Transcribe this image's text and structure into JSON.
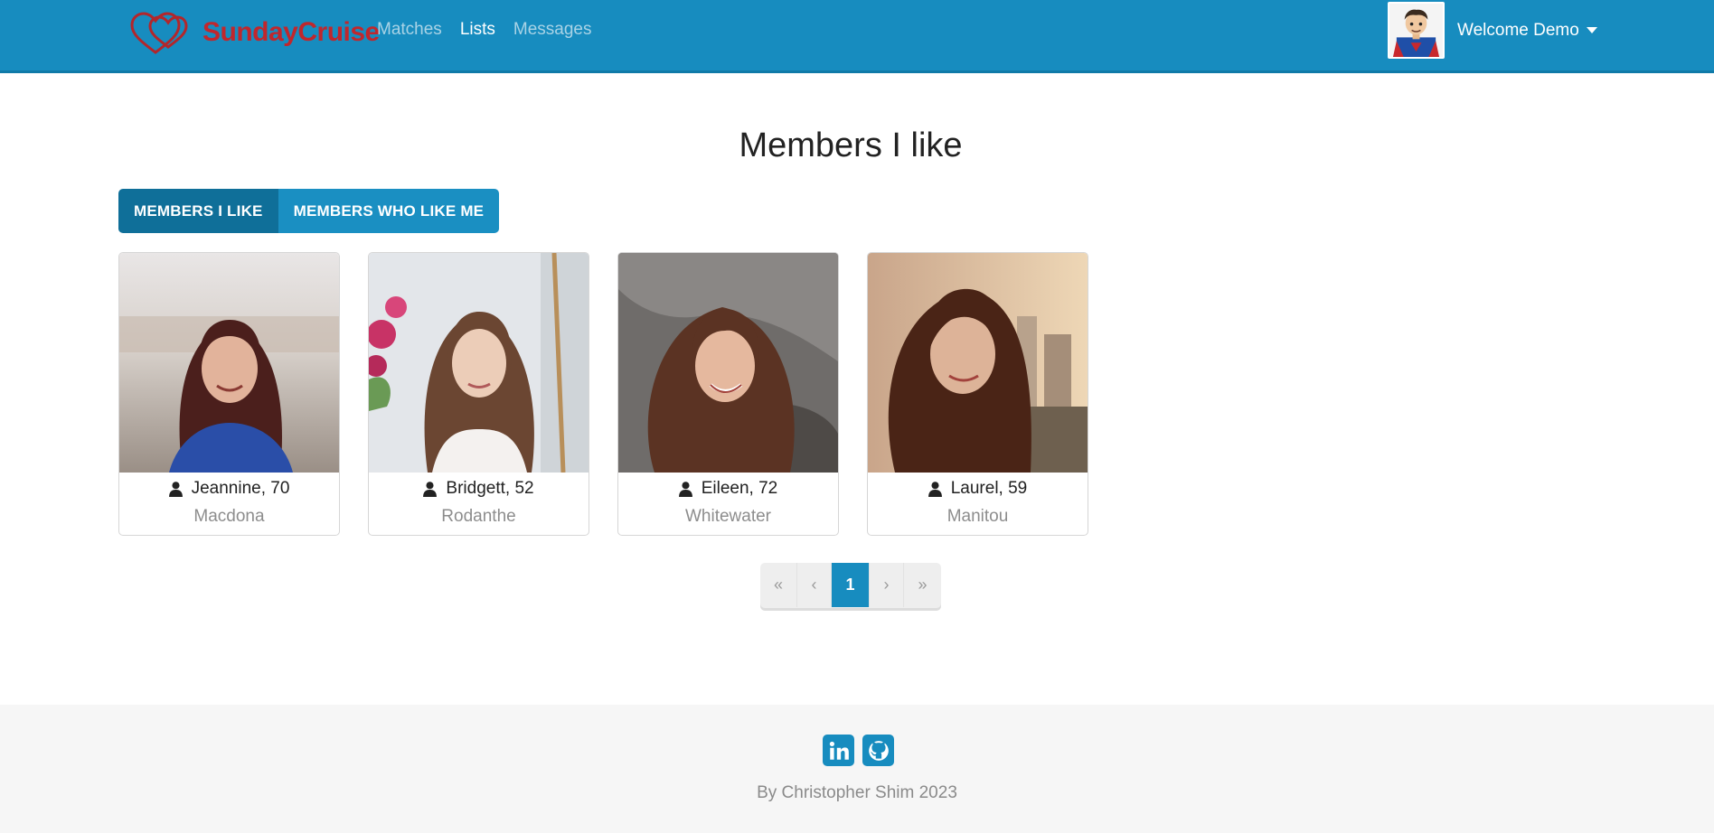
{
  "brand": {
    "name": "SundayCruise",
    "color": "#c0272d",
    "icon": "hearts-logo"
  },
  "nav": {
    "links": [
      {
        "label": "Matches",
        "active": false
      },
      {
        "label": "Lists",
        "active": true
      },
      {
        "label": "Messages",
        "active": false
      }
    ]
  },
  "user": {
    "welcome": "Welcome Demo",
    "avatar_icon": "superhero-avatar"
  },
  "page": {
    "title": "Members I like"
  },
  "tabs": [
    {
      "label": "Members I like",
      "active": true
    },
    {
      "label": "Members who like me",
      "active": false
    }
  ],
  "members": [
    {
      "name_age": "Jeannine, 70",
      "city": "Macdona"
    },
    {
      "name_age": "Bridgett, 52",
      "city": "Rodanthe"
    },
    {
      "name_age": "Eileen, 72",
      "city": "Whitewater"
    },
    {
      "name_age": "Laurel, 59",
      "city": "Manitou"
    }
  ],
  "pagination": {
    "first": "«",
    "prev": "‹",
    "current": "1",
    "next": "›",
    "last": "»"
  },
  "footer": {
    "text": "By Christopher Shim 2023",
    "icons": [
      "linkedin-icon",
      "github-icon"
    ]
  },
  "colors": {
    "primary": "#178cbf",
    "primary_dark": "#0f6f99",
    "footer_bg": "#f6f6f6"
  }
}
